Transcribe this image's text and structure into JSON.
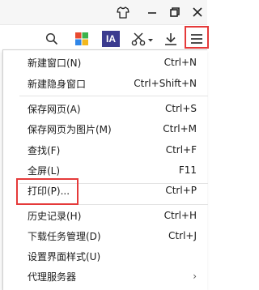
{
  "titlebar": {
    "skin_icon": "tshirt-icon",
    "minimize_icon": "minimize-icon",
    "restore_icon": "restore-icon",
    "menu_icon": "hamburger-menu-icon"
  },
  "toolbar": {
    "search_icon": "search-icon",
    "apps_icon": "apps-grid-icon",
    "ia_label": "IA",
    "cut_icon": "scissors-icon",
    "download_icon": "download-icon",
    "menu_icon": "hamburger-menu-icon",
    "colors": {
      "ia_bg": "#3b3b8f",
      "apps_red": "#e84a2f",
      "apps_green": "#3bb34a",
      "apps_blue": "#2f86e8",
      "apps_yellow": "#f2b81f",
      "highlight": "#e53a3a"
    }
  },
  "menu": {
    "items": [
      {
        "label": "新建窗口(N)",
        "shortcut": "Ctrl+N"
      },
      {
        "label": "新建隐身窗口",
        "shortcut": "Ctrl+Shift+N"
      },
      {
        "label": "保存网页(A)",
        "shortcut": "Ctrl+S"
      },
      {
        "label": "保存网页为图片(M)",
        "shortcut": "Ctrl+M"
      },
      {
        "label": "查找(F)",
        "shortcut": "Ctrl+F"
      },
      {
        "label": "全屏(L)",
        "shortcut": "F11"
      },
      {
        "label": "打印(P)...",
        "shortcut": "Ctrl+P"
      },
      {
        "label": "历史记录(H)",
        "shortcut": "Ctrl+H"
      },
      {
        "label": "下载任务管理(D)",
        "shortcut": "Ctrl+J"
      },
      {
        "label": "设置界面样式(U)",
        "shortcut": ""
      },
      {
        "label": "代理服务器",
        "shortcut": "",
        "submenu_arrow": "›"
      }
    ]
  }
}
